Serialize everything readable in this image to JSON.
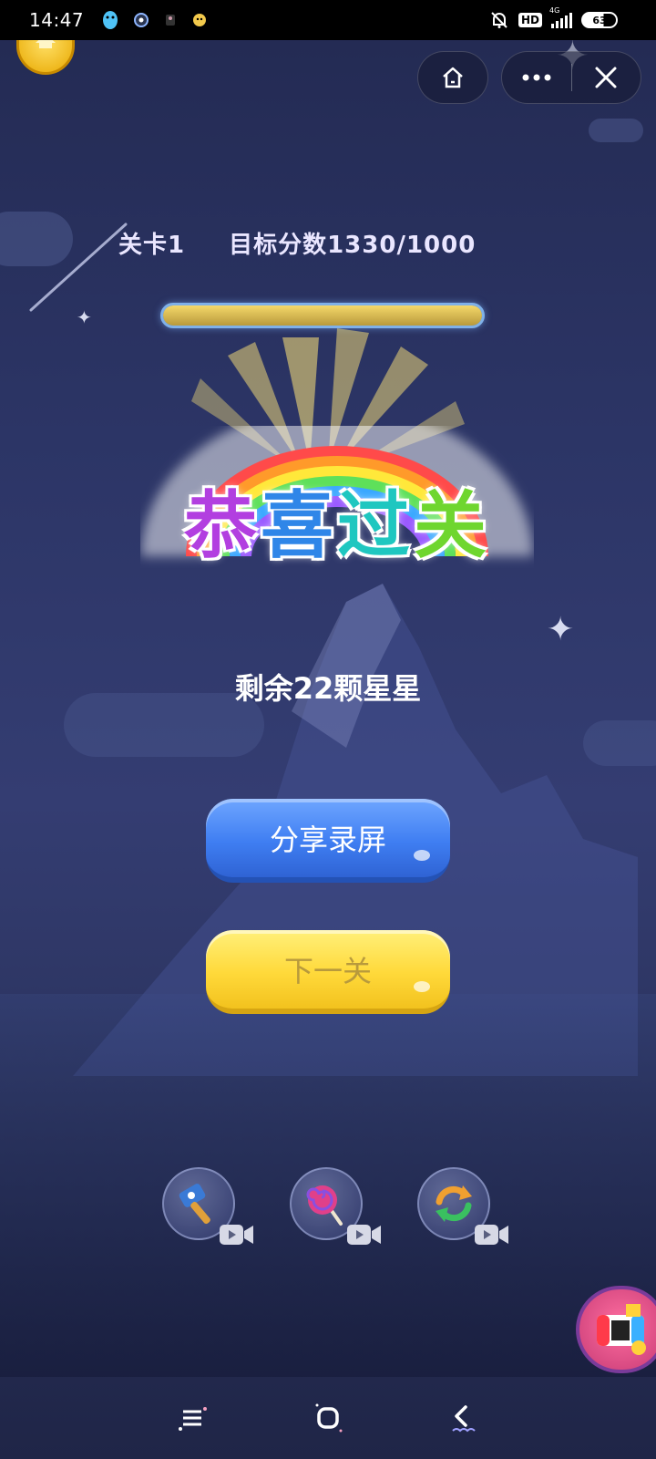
{
  "status_bar": {
    "time": "14:47",
    "hd_label": "HD",
    "network_label": "4G",
    "battery": "63"
  },
  "capsule": {
    "home_icon": "home-icon",
    "more_icon": "more-dots-icon",
    "close_icon": "close-icon"
  },
  "game": {
    "level_label": "关卡1",
    "target_label": "目标分数1330/1000",
    "progress_fraction": 1.0,
    "title_chars": [
      "恭",
      "喜",
      "过",
      "关"
    ],
    "remaining_text": "剩余22颗星星",
    "share_button": "分享录屏",
    "next_button": "下一关"
  },
  "powerups": [
    {
      "name": "hammer",
      "icon": "hammer-icon"
    },
    {
      "name": "lollipop",
      "icon": "lollipop-icon"
    },
    {
      "name": "shuffle",
      "icon": "shuffle-icon"
    }
  ],
  "colors": {
    "share_button": "#3f7ef2",
    "next_button": "#ffd93a",
    "background": "#2c3566"
  }
}
